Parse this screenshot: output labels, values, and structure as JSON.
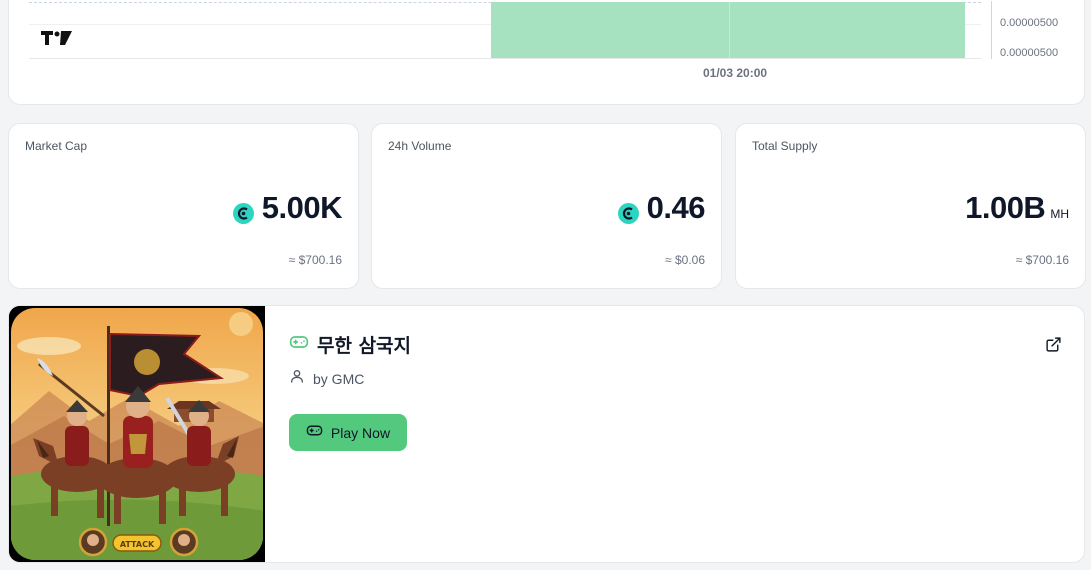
{
  "chart": {
    "y_ticks": [
      "0.00000500",
      "0.00000500"
    ],
    "x_tick": "01/03 20:00",
    "bar_color": "#a6e2bf"
  },
  "stats": [
    {
      "label": "Market Cap",
      "value": "5.00K",
      "unit": "",
      "sub": "≈ $700.16",
      "icon": "coin-icon"
    },
    {
      "label": "24h Volume",
      "value": "0.46",
      "unit": "",
      "sub": "≈ $0.06",
      "icon": "coin-icon"
    },
    {
      "label": "Total Supply",
      "value": "1.00B",
      "unit": "MH",
      "sub": "≈ $700.16",
      "icon": ""
    }
  ],
  "game": {
    "title": "무한 삼국지",
    "author": "by GMC",
    "play_label": "Play Now",
    "art_button": "ATTACK",
    "accent": "#53c97e"
  }
}
